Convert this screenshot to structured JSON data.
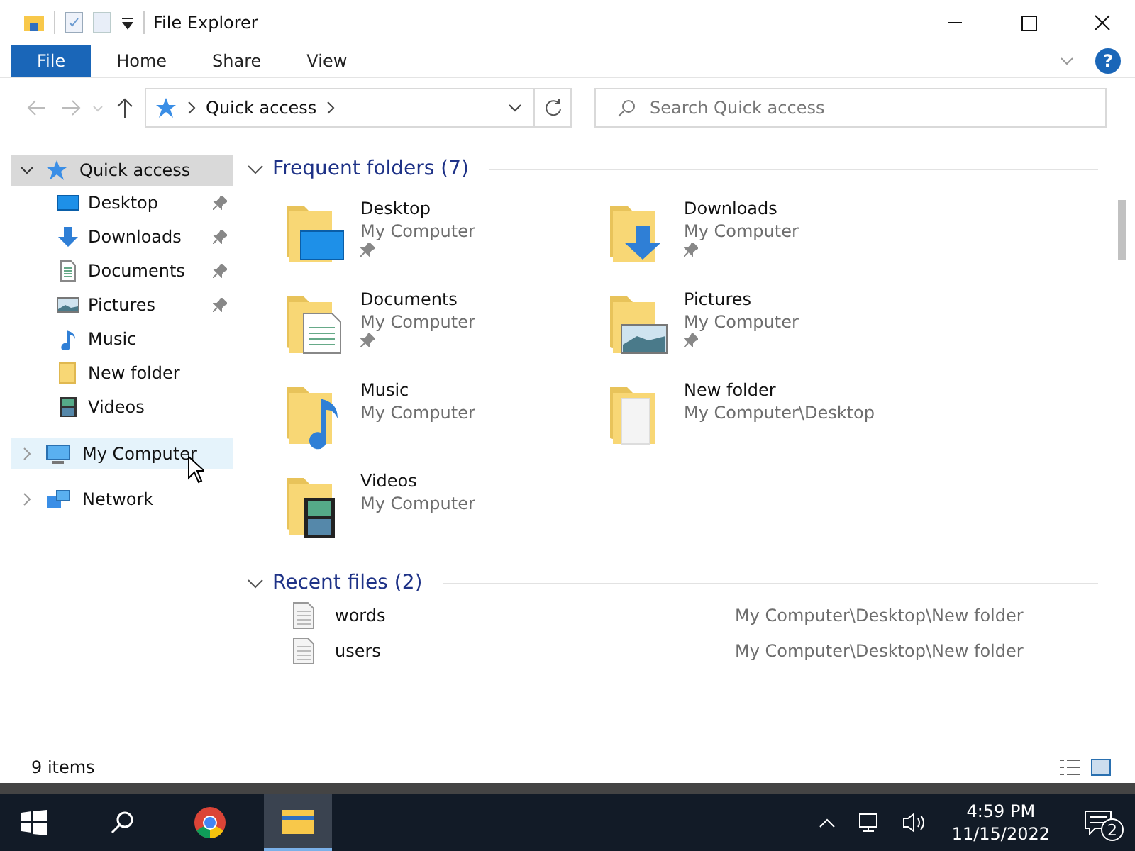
{
  "window": {
    "title": "File Explorer"
  },
  "ribbon": {
    "tabs": [
      {
        "label": "File",
        "selected": true
      },
      {
        "label": "Home",
        "selected": false
      },
      {
        "label": "Share",
        "selected": false
      },
      {
        "label": "View",
        "selected": false
      }
    ],
    "help": "?"
  },
  "address": {
    "crumb": "Quick access",
    "search": {
      "placeholder": "Search Quick access"
    }
  },
  "sidebar": {
    "items": [
      {
        "label": "Quick access",
        "kind": "star",
        "expanded": true,
        "selected": true,
        "hovered": false,
        "children": [
          {
            "label": "Desktop",
            "kind": "desktop",
            "pinned": true
          },
          {
            "label": "Downloads",
            "kind": "downloads",
            "pinned": true
          },
          {
            "label": "Documents",
            "kind": "documents",
            "pinned": true
          },
          {
            "label": "Pictures",
            "kind": "pictures",
            "pinned": true
          },
          {
            "label": "Music",
            "kind": "music",
            "pinned": false
          },
          {
            "label": "New folder",
            "kind": "folder",
            "pinned": false
          },
          {
            "label": "Videos",
            "kind": "videos",
            "pinned": false
          }
        ]
      },
      {
        "label": "My Computer",
        "kind": "computer",
        "expanded": false,
        "selected": false,
        "hovered": true
      },
      {
        "label": "Network",
        "kind": "network",
        "expanded": false,
        "selected": false,
        "hovered": false
      }
    ]
  },
  "frequent_folders": {
    "heading": "Frequent folders (7)",
    "items": [
      {
        "name": "Desktop",
        "location": "My Computer",
        "kind": "desktop",
        "pinned": true
      },
      {
        "name": "Downloads",
        "location": "My Computer",
        "kind": "downloads",
        "pinned": true
      },
      {
        "name": "Documents",
        "location": "My Computer",
        "kind": "documents",
        "pinned": true
      },
      {
        "name": "Pictures",
        "location": "My Computer",
        "kind": "pictures",
        "pinned": true
      },
      {
        "name": "Music",
        "location": "My Computer",
        "kind": "music",
        "pinned": false
      },
      {
        "name": "New folder",
        "location": "My Computer\\Desktop",
        "kind": "folder",
        "pinned": false
      },
      {
        "name": "Videos",
        "location": "My Computer",
        "kind": "videos",
        "pinned": false
      }
    ]
  },
  "recent_files": {
    "heading": "Recent files (2)",
    "items": [
      {
        "name": "words",
        "path": "My Computer\\Desktop\\New folder"
      },
      {
        "name": "users",
        "path": "My Computer\\Desktop\\New folder"
      }
    ]
  },
  "status_bar": {
    "count": "9 items"
  },
  "taskbar": {
    "apps": [
      {
        "kind": "start",
        "active": false
      },
      {
        "kind": "search",
        "active": false
      },
      {
        "kind": "chrome",
        "active": false
      },
      {
        "kind": "explorer",
        "active": true
      }
    ],
    "time": "4:59 PM",
    "date": "11/15/2022",
    "notifications": "2"
  }
}
